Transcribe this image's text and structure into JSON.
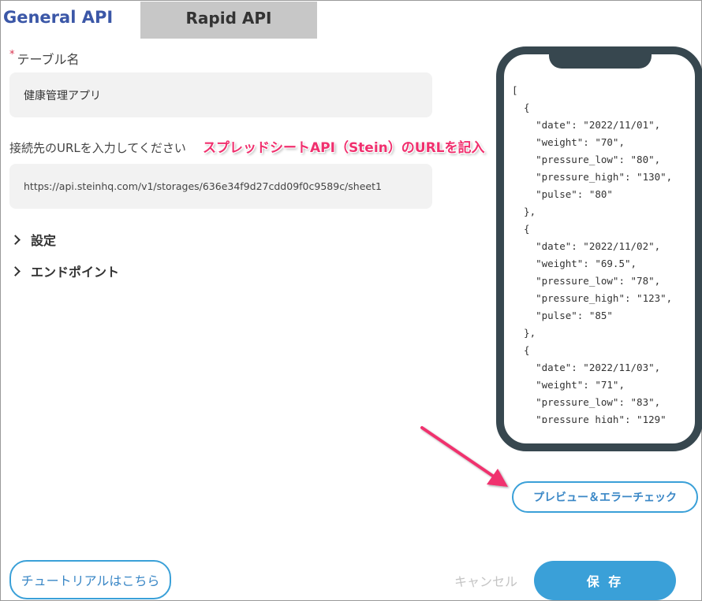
{
  "tabs": [
    {
      "label": "General API",
      "active": true
    },
    {
      "label": "Rapid API",
      "active": false
    }
  ],
  "form": {
    "table_name": {
      "required_mark": "*",
      "label": "テーブル名",
      "value": "健康管理アプリ"
    },
    "url": {
      "label": "接続先のURLを入力してください",
      "value": "https://api.steinhq.com/v1/storages/636e34f9d27cdd09f0c9589c/sheet1"
    },
    "sections": [
      {
        "label": "設定"
      },
      {
        "label": "エンドポイント"
      }
    ]
  },
  "annotation": "スプレッドシートAPI（Stein）のURLを記入",
  "preview_json": "[\n  {\n    \"date\": \"2022/11/01\",\n    \"weight\": \"70\",\n    \"pressure_low\": \"80\",\n    \"pressure_high\": \"130\",\n    \"pulse\": \"80\"\n  },\n  {\n    \"date\": \"2022/11/02\",\n    \"weight\": \"69.5\",\n    \"pressure_low\": \"78\",\n    \"pressure_high\": \"123\",\n    \"pulse\": \"85\"\n  },\n  {\n    \"date\": \"2022/11/03\",\n    \"weight\": \"71\",\n    \"pressure_low\": \"83\",\n    \"pressure_high\": \"129\"",
  "buttons": {
    "preview": "プレビュー＆エラーチェック",
    "tutorial": "チュートリアルはこちら",
    "cancel": "キャンセル",
    "save": "保 存"
  },
  "colors": {
    "accent": "#3aa0d8",
    "tab_active_text": "#3b57a7",
    "annotation": "#f0306e",
    "phone_frame": "#37474f"
  },
  "icons": {
    "section_toggle": "chevron-right-icon",
    "annotation_arrow": "arrow-icon"
  }
}
